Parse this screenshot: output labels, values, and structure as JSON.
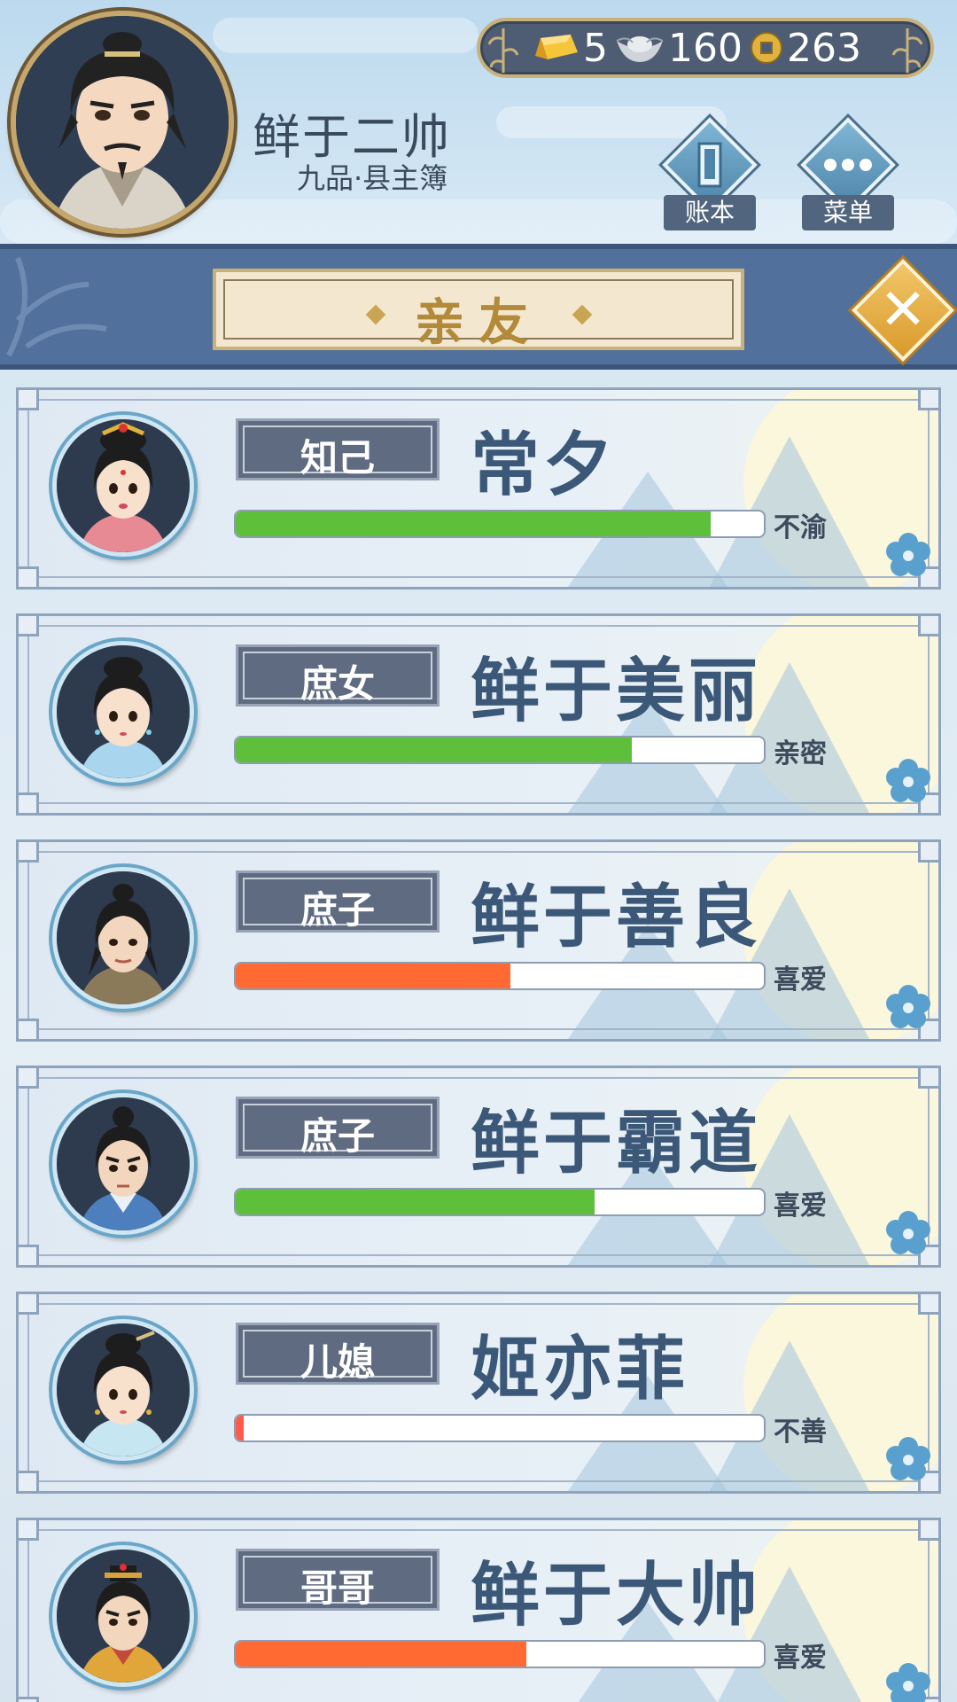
{
  "player": {
    "name": "鲜于二帅",
    "rank": "九品·县主簿"
  },
  "currency": {
    "gold": "5",
    "silver": "160",
    "coins": "263"
  },
  "menu": {
    "ledger_label": "账本",
    "menu_label": "菜单"
  },
  "panel": {
    "title": "亲友"
  },
  "colors": {
    "green": "#5dbf3a",
    "orange": "#ff6a33",
    "red": "#ff5a4a"
  },
  "relatives": [
    {
      "relation": "知己",
      "name": "常夕",
      "affection": 0.9,
      "bar_color": "green",
      "status": "不渝"
    },
    {
      "relation": "庶女",
      "name": "鲜于美丽",
      "affection": 0.75,
      "bar_color": "green",
      "status": "亲密"
    },
    {
      "relation": "庶子",
      "name": "鲜于善良",
      "affection": 0.52,
      "bar_color": "orange",
      "status": "喜爱"
    },
    {
      "relation": "庶子",
      "name": "鲜于霸道",
      "affection": 0.68,
      "bar_color": "green",
      "status": "喜爱"
    },
    {
      "relation": "儿媳",
      "name": "姬亦菲",
      "affection": 0.01,
      "bar_color": "red",
      "status": "不善"
    },
    {
      "relation": "哥哥",
      "name": "鲜于大帅",
      "affection": 0.55,
      "bar_color": "orange",
      "status": "喜爱"
    }
  ]
}
